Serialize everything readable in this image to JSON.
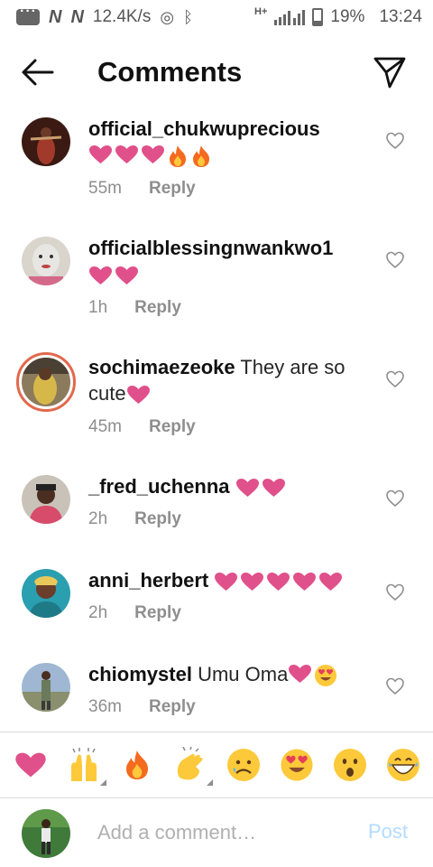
{
  "status_bar": {
    "network_speed": "12.4K/s",
    "battery": "19%",
    "time": "13:24",
    "carrier_marks": [
      "N",
      "N"
    ],
    "network_type": "H+"
  },
  "header": {
    "title": "Comments"
  },
  "comments": [
    {
      "username": "official_chukwuprecious",
      "text": "",
      "emojis": [
        "heart",
        "heart",
        "heart",
        "fire",
        "fire"
      ],
      "time": "55m",
      "reply_label": "Reply",
      "avatar_color": "#a23a2c"
    },
    {
      "username": "officialblessingnwankwo1",
      "text": "",
      "emojis": [
        "heart",
        "heart"
      ],
      "time": "1h",
      "reply_label": "Reply",
      "avatar_color": "#c9c3bd"
    },
    {
      "username": "sochimaezeoke",
      "text": "They are so cute",
      "emojis": [
        "heart"
      ],
      "time": "45m",
      "reply_label": "Reply",
      "avatar_color": "#6b5a3d"
    },
    {
      "username": "_fred_uchenna",
      "text": "",
      "emojis": [
        "heart",
        "heart"
      ],
      "time": "2h",
      "reply_label": "Reply",
      "avatar_color": "#d74b6b"
    },
    {
      "username": "anni_herbert",
      "text": "",
      "emojis": [
        "heart",
        "heart",
        "heart",
        "heart",
        "heart"
      ],
      "time": "2h",
      "reply_label": "Reply",
      "avatar_color": "#2aa7b8"
    },
    {
      "username": "chiomystel",
      "text": "Umu Oma",
      "emojis": [
        "heart",
        "heart-eyes"
      ],
      "time": "36m",
      "reply_label": "Reply",
      "avatar_color": "#7c8c6e"
    }
  ],
  "emoji_bar": [
    "heart",
    "raised-hands",
    "fire",
    "clapping-hands",
    "sad-face",
    "heart-eyes",
    "surprised-face",
    "grinning-face"
  ],
  "composer": {
    "placeholder": "Add a comment…",
    "post_label": "Post"
  },
  "colors": {
    "heart": "#e0508a",
    "post_disabled": "#b3dbff",
    "meta": "#8e8e8e",
    "story_ring": "#e2694c"
  }
}
